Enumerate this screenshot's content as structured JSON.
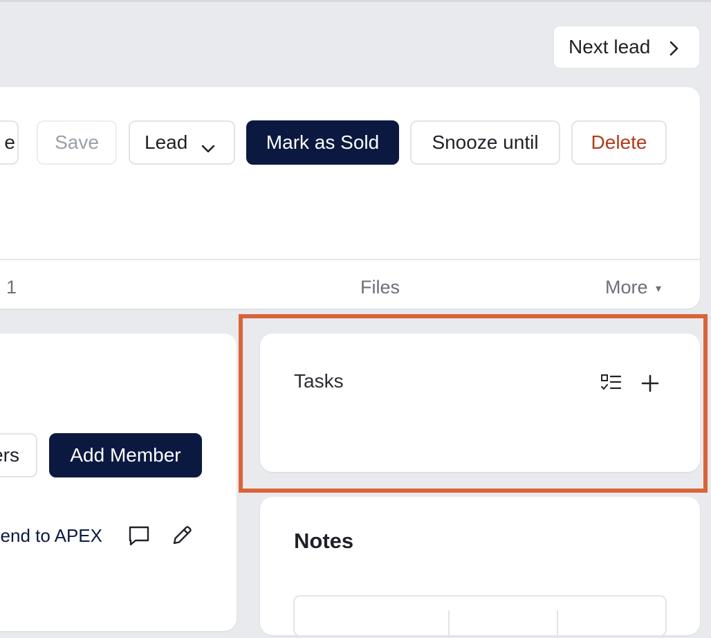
{
  "header": {
    "next_lead_label": "Next lead"
  },
  "toolbar": {
    "partial_left_label": "e",
    "save_label": "Save",
    "status_label": "Lead",
    "mark_sold_label": "Mark as Sold",
    "snooze_label": "Snooze until",
    "delete_label": "Delete"
  },
  "tabs": {
    "partial_count": "1",
    "files_label": "Files",
    "more_label": "More",
    "more_caret": "▾"
  },
  "members": {
    "partial_button_label": "ers",
    "add_member_label": "Add Member",
    "send_to_label": "Send to APEX"
  },
  "tasks": {
    "title": "Tasks"
  },
  "notes": {
    "title": "Notes"
  },
  "colors": {
    "background": "#e9eaed",
    "primary": "#0b1941",
    "danger": "#b23a1c",
    "highlight": "#d9643a"
  }
}
